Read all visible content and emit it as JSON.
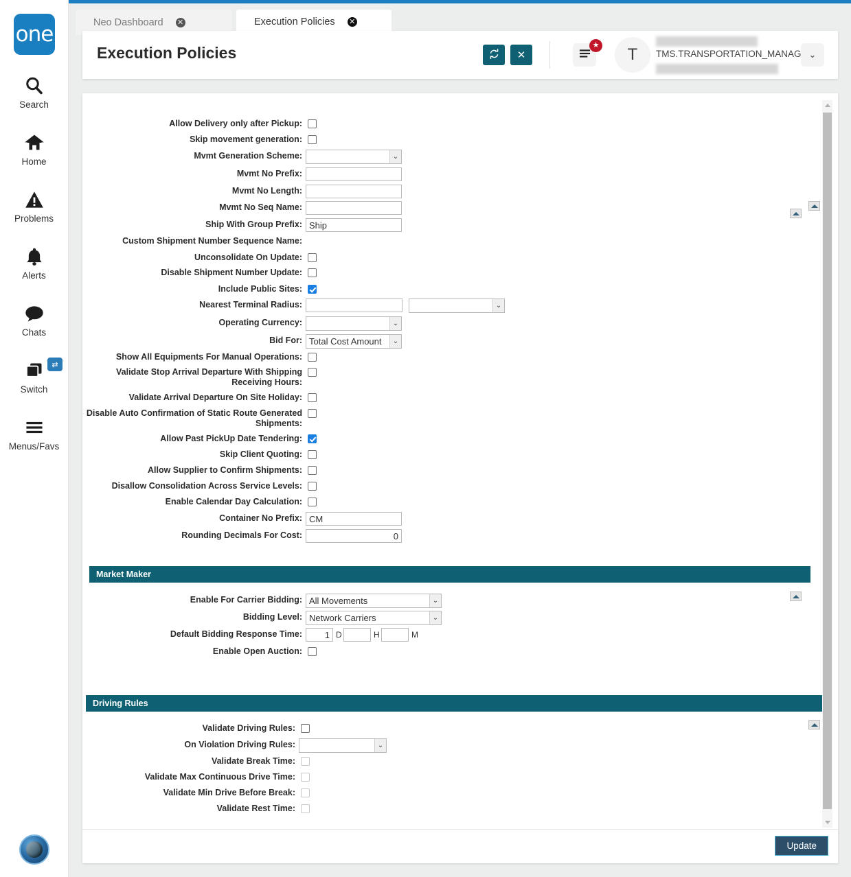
{
  "brand": {
    "logo_text": "one",
    "logo_color": "#1a7fc1"
  },
  "theme": {
    "accent_teal": "#0e6072",
    "accent_blue": "#1a7fc1",
    "checkbox_checked": "#1a7fe0",
    "update_button_bg": "#2d4e68",
    "update_button_border": "#4ab3cf"
  },
  "rail": {
    "items": [
      {
        "label": "Search",
        "icon": "search-icon"
      },
      {
        "label": "Home",
        "icon": "home-icon"
      },
      {
        "label": "Problems",
        "icon": "warning-triangle-icon"
      },
      {
        "label": "Alerts",
        "icon": "bell-icon"
      },
      {
        "label": "Chats",
        "icon": "chat-bubble-icon"
      },
      {
        "label": "Switch",
        "icon": "windows-stack-icon",
        "badge_icon": "swap-arrows-icon"
      },
      {
        "label": "Menus/Favs",
        "icon": "hamburger-icon"
      }
    ],
    "assistant_icon": "ai-assistant-orb-icon"
  },
  "tabs": [
    {
      "label": "Neo Dashboard",
      "active": false,
      "close_icon": "close-circle-icon"
    },
    {
      "label": "Execution Policies",
      "active": true,
      "close_icon": "close-circle-icon"
    }
  ],
  "header": {
    "title": "Execution Policies",
    "refresh_icon": "refresh-icon",
    "close_icon": "x-icon",
    "menu_icon": "list-menu-icon",
    "menu_badge_icon": "star-icon",
    "avatar_initial": "T",
    "username": "TMS.TRANSPORTATION_MANAGER",
    "caret_icon": "chevron-down-icon"
  },
  "form": {
    "general_fields": [
      {
        "id": "allow-delivery-only-after-pickup",
        "label": "Allow Delivery only after Pickup:",
        "type": "checkbox",
        "checked": false
      },
      {
        "id": "skip-movement-generation",
        "label": "Skip movement generation:",
        "type": "checkbox",
        "checked": false
      },
      {
        "id": "mvmt-generation-scheme",
        "label": "Mvmt Generation Scheme:",
        "type": "select",
        "value": ""
      },
      {
        "id": "mvmt-no-prefix",
        "label": "Mvmt No Prefix:",
        "type": "text",
        "value": ""
      },
      {
        "id": "mvmt-no-length",
        "label": "Mvmt No Length:",
        "type": "text",
        "value": ""
      },
      {
        "id": "mvmt-no-seq-name",
        "label": "Mvmt No Seq Name:",
        "type": "text",
        "value": ""
      },
      {
        "id": "ship-with-group-prefix",
        "label": "Ship With Group Prefix:",
        "type": "text",
        "value": "Ship"
      },
      {
        "id": "custom-shipment-number-sequence-name",
        "label": "Custom Shipment Number Sequence Name:",
        "type": "label-only",
        "value": ""
      },
      {
        "id": "unconsolidate-on-update",
        "label": "Unconsolidate On Update:",
        "type": "checkbox",
        "checked": false
      },
      {
        "id": "disable-shipment-number-update",
        "label": "Disable Shipment Number Update:",
        "type": "checkbox",
        "checked": false
      },
      {
        "id": "include-public-sites",
        "label": "Include Public Sites:",
        "type": "checkbox",
        "checked": true
      },
      {
        "id": "nearest-terminal-radius",
        "label": "Nearest Terminal Radius:",
        "type": "text-plus-select",
        "value": "",
        "unit_value": ""
      },
      {
        "id": "operating-currency",
        "label": "Operating Currency:",
        "type": "select",
        "value": ""
      },
      {
        "id": "bid-for",
        "label": "Bid For:",
        "type": "select",
        "value": "Total Cost Amount"
      },
      {
        "id": "show-all-equipments-for-manual-operations",
        "label": "Show All Equipments For Manual Operations:",
        "type": "checkbox",
        "checked": false
      },
      {
        "id": "validate-stop-arrival-departure-with-shipping-receiving-hours",
        "label": "Validate Stop Arrival Departure With Shipping Receiving Hours:",
        "type": "checkbox",
        "checked": false
      },
      {
        "id": "validate-arrival-departure-on-site-holiday",
        "label": "Validate Arrival Departure On Site Holiday:",
        "type": "checkbox",
        "checked": false
      },
      {
        "id": "disable-auto-confirmation-of-static-route-generated-shipments",
        "label": "Disable Auto Confirmation of Static Route Generated Shipments:",
        "type": "checkbox",
        "checked": false
      },
      {
        "id": "allow-past-pickup-date-tendering",
        "label": "Allow Past PickUp Date Tendering:",
        "type": "checkbox",
        "checked": true
      },
      {
        "id": "skip-client-quoting",
        "label": "Skip Client Quoting:",
        "type": "checkbox",
        "checked": false
      },
      {
        "id": "allow-supplier-to-confirm-shipments",
        "label": "Allow Supplier to Confirm Shipments:",
        "type": "checkbox",
        "checked": false
      },
      {
        "id": "disallow-consolidation-across-service-levels",
        "label": "Disallow Consolidation Across Service Levels:",
        "type": "checkbox",
        "checked": false
      },
      {
        "id": "enable-calendar-day-calculation",
        "label": "Enable Calendar Day Calculation:",
        "type": "checkbox",
        "checked": false
      },
      {
        "id": "container-no-prefix",
        "label": "Container No Prefix:",
        "type": "text",
        "value": "CM"
      },
      {
        "id": "rounding-decimals-for-cost",
        "label": "Rounding Decimals For Cost:",
        "type": "text-right",
        "value": "0"
      }
    ],
    "market_maker": {
      "title": "Market Maker",
      "fields": [
        {
          "id": "enable-for-carrier-bidding",
          "label": "Enable For Carrier Bidding:",
          "type": "select",
          "value": "All Movements"
        },
        {
          "id": "bidding-level",
          "label": "Bidding Level:",
          "type": "select",
          "value": "Network Carriers"
        },
        {
          "id": "default-bidding-response-time",
          "label": "Default Bidding Response Time:",
          "type": "duration",
          "days": "1",
          "days_unit": "D",
          "hours": "",
          "hours_unit": "H",
          "minutes": "",
          "minutes_unit": "M"
        },
        {
          "id": "enable-open-auction",
          "label": "Enable Open Auction:",
          "type": "checkbox",
          "checked": false
        }
      ]
    },
    "driving_rules": {
      "title": "Driving Rules",
      "fields": [
        {
          "id": "validate-driving-rules",
          "label": "Validate Driving Rules:",
          "type": "checkbox",
          "checked": false,
          "disabled": false
        },
        {
          "id": "on-violation-driving-rules",
          "label": "On Violation Driving Rules:",
          "type": "select",
          "value": ""
        },
        {
          "id": "validate-break-time",
          "label": "Validate Break Time:",
          "type": "checkbox",
          "checked": false,
          "disabled": true
        },
        {
          "id": "validate-max-continuous-drive-time",
          "label": "Validate Max Continuous Drive Time:",
          "type": "checkbox",
          "checked": false,
          "disabled": true
        },
        {
          "id": "validate-min-drive-before-break",
          "label": "Validate Min Drive Before Break:",
          "type": "checkbox",
          "checked": false,
          "disabled": true
        },
        {
          "id": "validate-rest-time",
          "label": "Validate Rest Time:",
          "type": "checkbox",
          "checked": false,
          "disabled": true
        }
      ]
    },
    "collapse_icon": "collapse-up-icon",
    "update_label": "Update"
  },
  "scrollbar": {
    "up_icon": "scroll-up-arrow-icon",
    "down_icon": "scroll-down-arrow-icon"
  }
}
